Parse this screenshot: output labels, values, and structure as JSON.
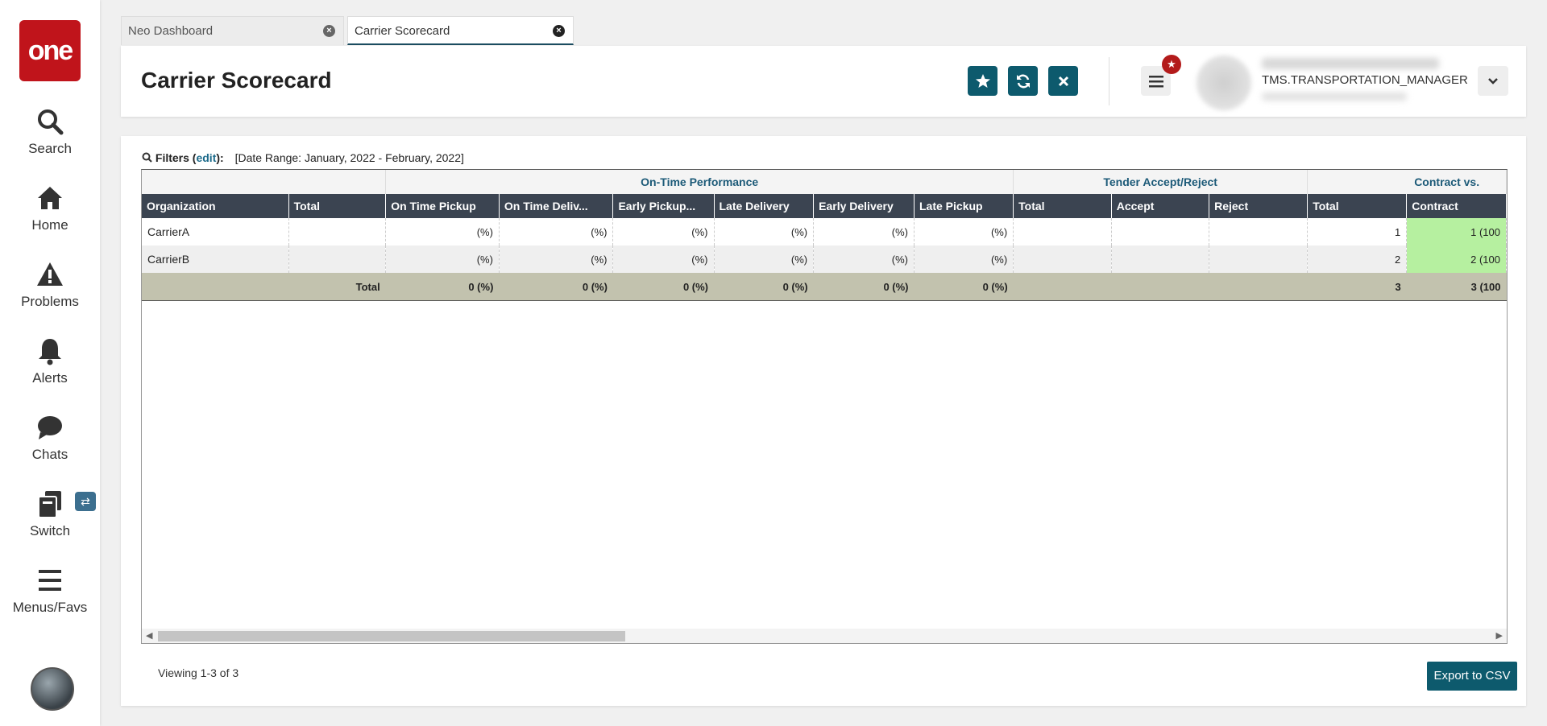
{
  "sidebar": {
    "logo": "one",
    "items": [
      {
        "label": "Search",
        "icon": "search-icon"
      },
      {
        "label": "Home",
        "icon": "home-icon"
      },
      {
        "label": "Problems",
        "icon": "warning-icon"
      },
      {
        "label": "Alerts",
        "icon": "bell-icon"
      },
      {
        "label": "Chats",
        "icon": "chat-icon"
      },
      {
        "label": "Switch",
        "icon": "switch-icon"
      },
      {
        "label": "Menus/Favs",
        "icon": "hamburger-icon"
      }
    ],
    "switch_badge": "⇄"
  },
  "tabs": [
    {
      "label": "Neo Dashboard"
    },
    {
      "label": "Carrier Scorecard"
    }
  ],
  "header": {
    "title": "Carrier Scorecard",
    "user_role": "TMS.TRANSPORTATION_MANAGER"
  },
  "filters": {
    "label": "Filters",
    "edit": "edit",
    "range": "[Date Range: January, 2022 - February, 2022]"
  },
  "table": {
    "groups": [
      "On-Time Performance",
      "Tender Accept/Reject",
      "Contract vs."
    ],
    "headers": [
      "Organization",
      "Total",
      "On Time Pickup",
      "On Time Deliv...",
      "Early Pickup...",
      "Late Delivery",
      "Early Delivery",
      "Late Pickup",
      "Total",
      "Accept",
      "Reject",
      "Total",
      "Contract"
    ],
    "rows": [
      [
        "CarrierA",
        "",
        "(%)",
        "(%)",
        "(%)",
        "(%)",
        "(%)",
        "(%)",
        "",
        "",
        "",
        "1",
        "1 (100"
      ],
      [
        "CarrierB",
        "",
        "(%)",
        "(%)",
        "(%)",
        "(%)",
        "(%)",
        "(%)",
        "",
        "",
        "",
        "2",
        "2 (100"
      ]
    ],
    "total_row": [
      "Total",
      "0 (%)",
      "0 (%)",
      "0 (%)",
      "0 (%)",
      "0 (%)",
      "0 (%)",
      "",
      "",
      "",
      "3",
      "3 (100"
    ]
  },
  "footer": {
    "viewing": "Viewing 1-3 of 3",
    "export": "Export to CSV"
  },
  "colors": {
    "accent": "#0d5a6d",
    "logo": "#c0141b",
    "header_row": "#3b4451",
    "total_row": "#c2c2ae",
    "highlight": "#b6f0a0"
  }
}
